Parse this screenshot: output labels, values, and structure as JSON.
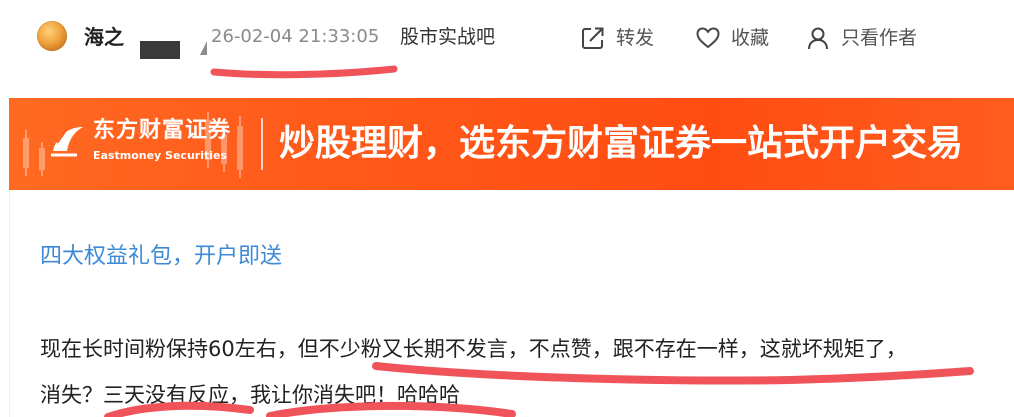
{
  "header": {
    "author_name": "海之",
    "post_time": "26-02-04 21:33:05",
    "forum_name": "股市实战吧",
    "actions": {
      "share_label": "转发",
      "favorite_label": "收藏",
      "author_only_label": "只看作者"
    }
  },
  "banner": {
    "brand_cn": "东方财富证券",
    "brand_en": "Eastmoney Securities",
    "slogan": "炒股理财，选东方财富证券一站式开户交易"
  },
  "post": {
    "promo_link": "四大权益礼包，开户即送",
    "lines": [
      "现在长时间粉保持60左右，但不少粉又长期不发言，不点赞，跟不存在一样，这就坏规矩了，",
      "消失？三天没有反应，我让你消失吧！哈哈哈"
    ]
  },
  "colors": {
    "accent_orange": "#ff5a1a",
    "link_blue": "#3d8ad6",
    "scribble_red": "#f0545a"
  },
  "icons": {
    "share": "share-icon",
    "favorite": "heart-icon",
    "author": "user-icon"
  }
}
